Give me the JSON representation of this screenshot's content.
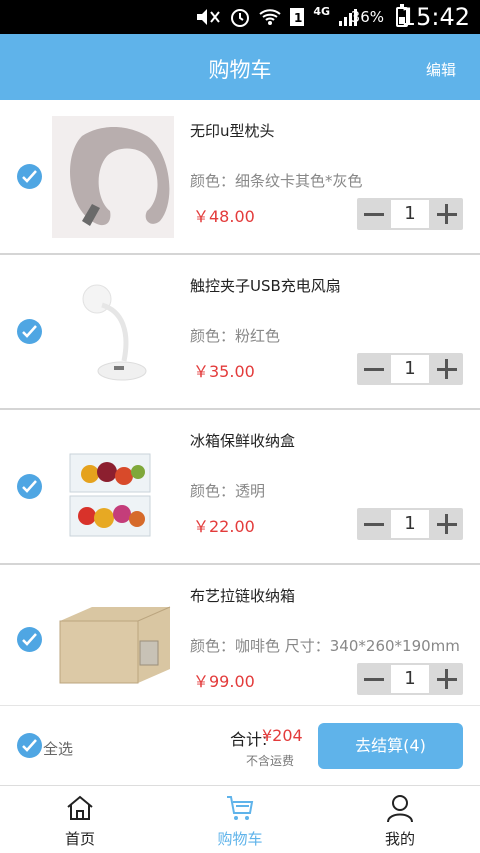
{
  "status": {
    "battery": "36%",
    "time": "15:42",
    "network": "4G"
  },
  "header": {
    "title": "购物车",
    "edit": "编辑",
    "bg_color": "#5fb3ea"
  },
  "items": [
    {
      "name": "无印u型枕头",
      "spec": "颜色：细条纹卡其色*灰色",
      "price": "￥48.00",
      "qty": "1",
      "checked": true
    },
    {
      "name": "触控夹子USB充电风扇",
      "spec": "颜色：粉红色",
      "price": "￥35.00",
      "qty": "1",
      "checked": true
    },
    {
      "name": "冰箱保鲜收纳盒",
      "spec": "颜色：透明",
      "price": "￥22.00",
      "qty": "1",
      "checked": true
    },
    {
      "name": "布艺拉链收纳箱",
      "spec": "颜色：咖啡色 尺寸：340*260*190mm",
      "price": "￥99.00",
      "qty": "1",
      "checked": true
    }
  ],
  "footer": {
    "select_all": "全选",
    "total_label": "合计:",
    "total_value": "¥204",
    "shipping_note": "不含运费",
    "checkout": "去结算(4)"
  },
  "tabs": [
    {
      "label": "首页",
      "icon": "home-icon"
    },
    {
      "label": "购物车",
      "icon": "cart-icon",
      "active": true
    },
    {
      "label": "我的",
      "icon": "user-icon"
    }
  ]
}
